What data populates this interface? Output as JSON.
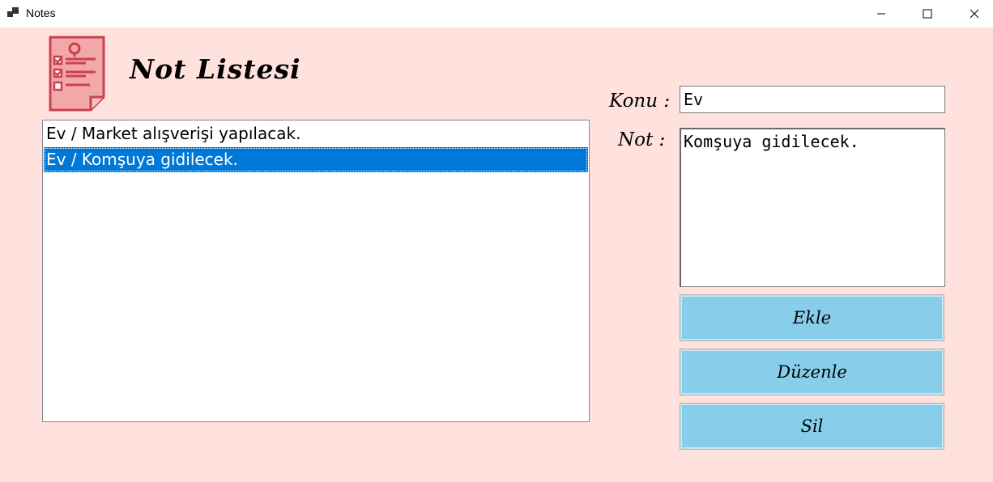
{
  "window": {
    "title": "Notes",
    "icon": "app-window-icon",
    "controls": [
      "minimize-icon",
      "maximize-icon",
      "close-icon"
    ]
  },
  "header": {
    "title": "Not Listesi",
    "logo": "checklist-document-icon"
  },
  "notes_list": {
    "items": [
      "Ev / Market alışverişi yapılacak.",
      "Ev / Komşuya gidilecek."
    ],
    "selected_index": 1
  },
  "form": {
    "konu_label": "Konu :",
    "konu_value": "Ev",
    "not_label": "Not :",
    "not_value": "Komşuya gidilecek."
  },
  "buttons": {
    "add": "Ekle",
    "edit": "Düzenle",
    "delete": "Sil"
  },
  "colors": {
    "background": "#ffe1de",
    "button": "#87ceeb",
    "selection": "#0078d7",
    "logo": "#c9424f"
  }
}
